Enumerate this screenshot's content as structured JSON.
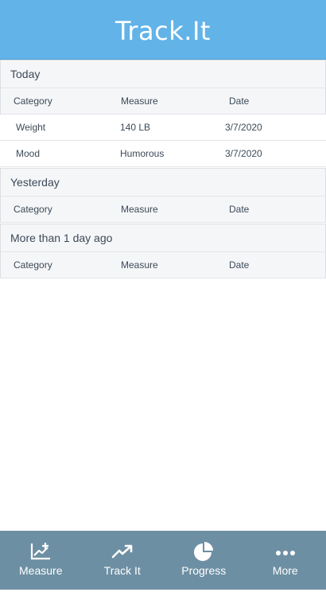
{
  "header": {
    "title": "Track.It"
  },
  "columns": {
    "category": "Category",
    "measure": "Measure",
    "date": "Date"
  },
  "sections": {
    "today": {
      "title": "Today",
      "rows": [
        {
          "category": "Weight",
          "measure": "140 LB",
          "date": "3/7/2020"
        },
        {
          "category": "Mood",
          "measure": "Humorous",
          "date": "3/7/2020"
        }
      ]
    },
    "yesterday": {
      "title": "Yesterday"
    },
    "older": {
      "title": "More than 1 day ago"
    }
  },
  "tabbar": {
    "tabs": [
      {
        "label": "Measure",
        "icon": "chart-plus-icon"
      },
      {
        "label": "Track It",
        "icon": "trend-up-icon"
      },
      {
        "label": "Progress",
        "icon": "pie-chart-icon"
      },
      {
        "label": "More",
        "icon": "more-dots-icon"
      }
    ]
  },
  "colors": {
    "header": "#62b3e8",
    "tabbar": "#6d8fa3",
    "section_bg": "#f5f6f8",
    "text": "#3c4a58"
  }
}
